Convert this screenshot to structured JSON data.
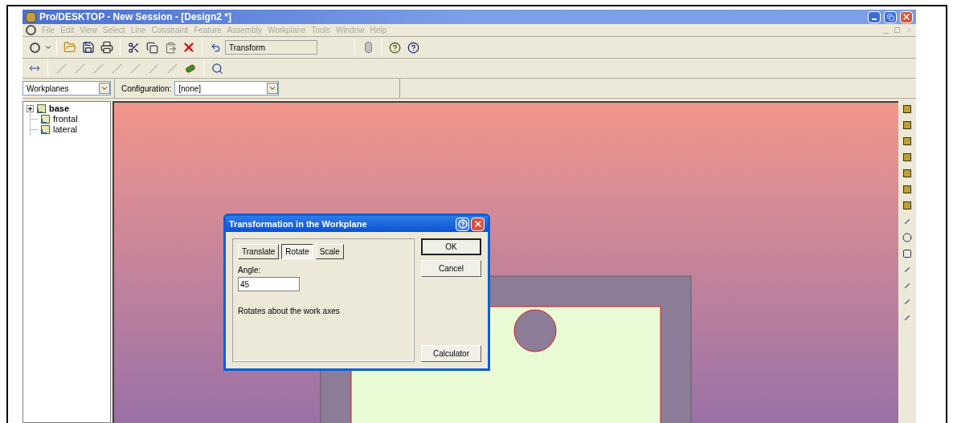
{
  "window": {
    "title": "Pro/DESKTOP - New Session - [Design2 *]"
  },
  "menu": [
    {
      "label": "File"
    },
    {
      "label": "Edit"
    },
    {
      "label": "View"
    },
    {
      "label": "Select"
    },
    {
      "label": "Line"
    },
    {
      "label": "Constraint"
    },
    {
      "label": "Feature"
    },
    {
      "label": "Assembly"
    },
    {
      "label": "Workplane"
    },
    {
      "label": "Tools"
    },
    {
      "label": "Window"
    },
    {
      "label": "Help"
    }
  ],
  "toolbar": {
    "undo_label": "Transform"
  },
  "selectors": {
    "browser": "Workplanes",
    "configuration_label": "Configuration:",
    "configuration": "[none]"
  },
  "tree": [
    {
      "label": "base",
      "expanded": false,
      "bold": true,
      "children": [
        {
          "label": "frontal",
          "bold": false
        },
        {
          "label": "lateral",
          "bold": false
        }
      ]
    }
  ],
  "dialog": {
    "title": "Transformation in the Workplane",
    "tabs": [
      {
        "label": "Translate",
        "selected": false
      },
      {
        "label": "Rotate",
        "selected": true
      },
      {
        "label": "Scale",
        "selected": false
      }
    ],
    "field_label": "Angle:",
    "field_value": "45",
    "description": "Rotates about the work axes",
    "buttons": [
      {
        "label": "OK",
        "default": true
      },
      {
        "label": "Cancel",
        "default": false
      },
      {
        "label": "Calculator",
        "default": false
      }
    ]
  }
}
